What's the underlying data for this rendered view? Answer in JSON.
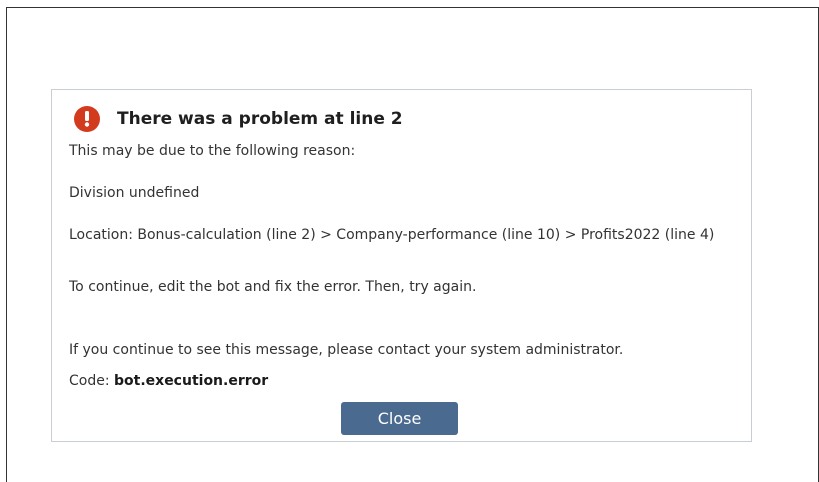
{
  "dialog": {
    "title": "There was a problem at line 2",
    "reason_intro": "This may be due to the following reason:",
    "reason": "Division undefined",
    "location": "Location: Bonus-calculation (line 2) > Company-performance (line 10) > Profits2022 (line 4)",
    "instruction": "To continue, edit the bot and fix the error. Then, try again.",
    "contact": "If you continue to see this message, please contact your system administrator.",
    "code_label": "Code: ",
    "code_value": "bot.execution.error",
    "close_label": "Close"
  },
  "colors": {
    "error_icon": "#d33b1f",
    "close_button_bg": "#4b6a8f",
    "dialog_border": "#c9ced4"
  },
  "icons": {
    "title_icon": "exclamation-circle-icon"
  }
}
